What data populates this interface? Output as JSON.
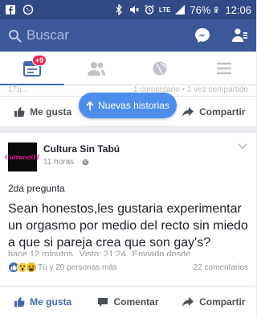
{
  "status_bar": {
    "lte": "LTE",
    "battery": "76%",
    "time": "12:06"
  },
  "nav": {
    "search_placeholder": "Buscar"
  },
  "tabs": {
    "notifications_badge": "+9"
  },
  "prev_post": {
    "faded_left": "17a...",
    "faded_right": "1 comentario • 1 vez compartido",
    "actions": {
      "like": "Me gusta",
      "share": "Compartir"
    }
  },
  "new_stories_label": "Nuevas historias",
  "post": {
    "author": "Cultura Sin Tabú",
    "avatar_text": "CulturaSIT",
    "time": "11 horas",
    "subtitle": "2da pregunta",
    "body": "Sean honestos,les gustaria experimentar un orgasmo por medio del recto sin miedo a que si pareja crea que son gay's?",
    "cut_left": "hace 12 minutos",
    "cut_mid": "Visto: 21:24",
    "cut_right": "Enviado desde",
    "reactions_text": "Tú y 20 personas más",
    "comments_text": "22 comentarios",
    "actions": {
      "like": "Me gusta",
      "comment": "Comentar",
      "share": "Compartir"
    }
  },
  "colors": {
    "status_bar": "#2f4a84",
    "nav_bar": "#3b5998",
    "accent": "#4267b2",
    "new_stories": "#4d8eed"
  }
}
